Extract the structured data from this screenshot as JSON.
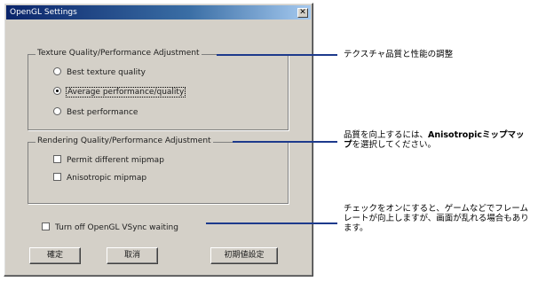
{
  "dialog": {
    "title": "OpenGL Settings",
    "close_symbol": "✕",
    "texture_group": {
      "label": "Texture Quality/Performance Adjustment",
      "options": [
        {
          "label": "Best texture quality",
          "selected": false
        },
        {
          "label": "Average performance/quality",
          "selected": true
        },
        {
          "label": "Best performance",
          "selected": false
        }
      ]
    },
    "render_group": {
      "label": "Rendering Quality/Performance Adjustment",
      "options": [
        {
          "label": "Permit different mipmap",
          "checked": false
        },
        {
          "label": "Anisotropic mipmap",
          "checked": false
        }
      ]
    },
    "vsync": {
      "label": "Turn off OpenGL VSync waiting",
      "checked": false
    },
    "buttons": {
      "ok": "確定",
      "cancel": "取消",
      "default": "初期値設定"
    }
  },
  "annotations": {
    "texture": "テクスチャ品質と性能の調整",
    "render_prefix": "品質を向上するには、",
    "render_bold": "Anisotropicミップマップ",
    "render_suffix": "を選択してください。",
    "vsync": "チェックをオンにすると、ゲームなどでフレームレートが向上しますが、画面が乱れる場合もあります。"
  },
  "colors": {
    "leader": "#1d3a8c",
    "dialog_bg": "#d4d0c8",
    "titlebar": "#0a246a"
  }
}
